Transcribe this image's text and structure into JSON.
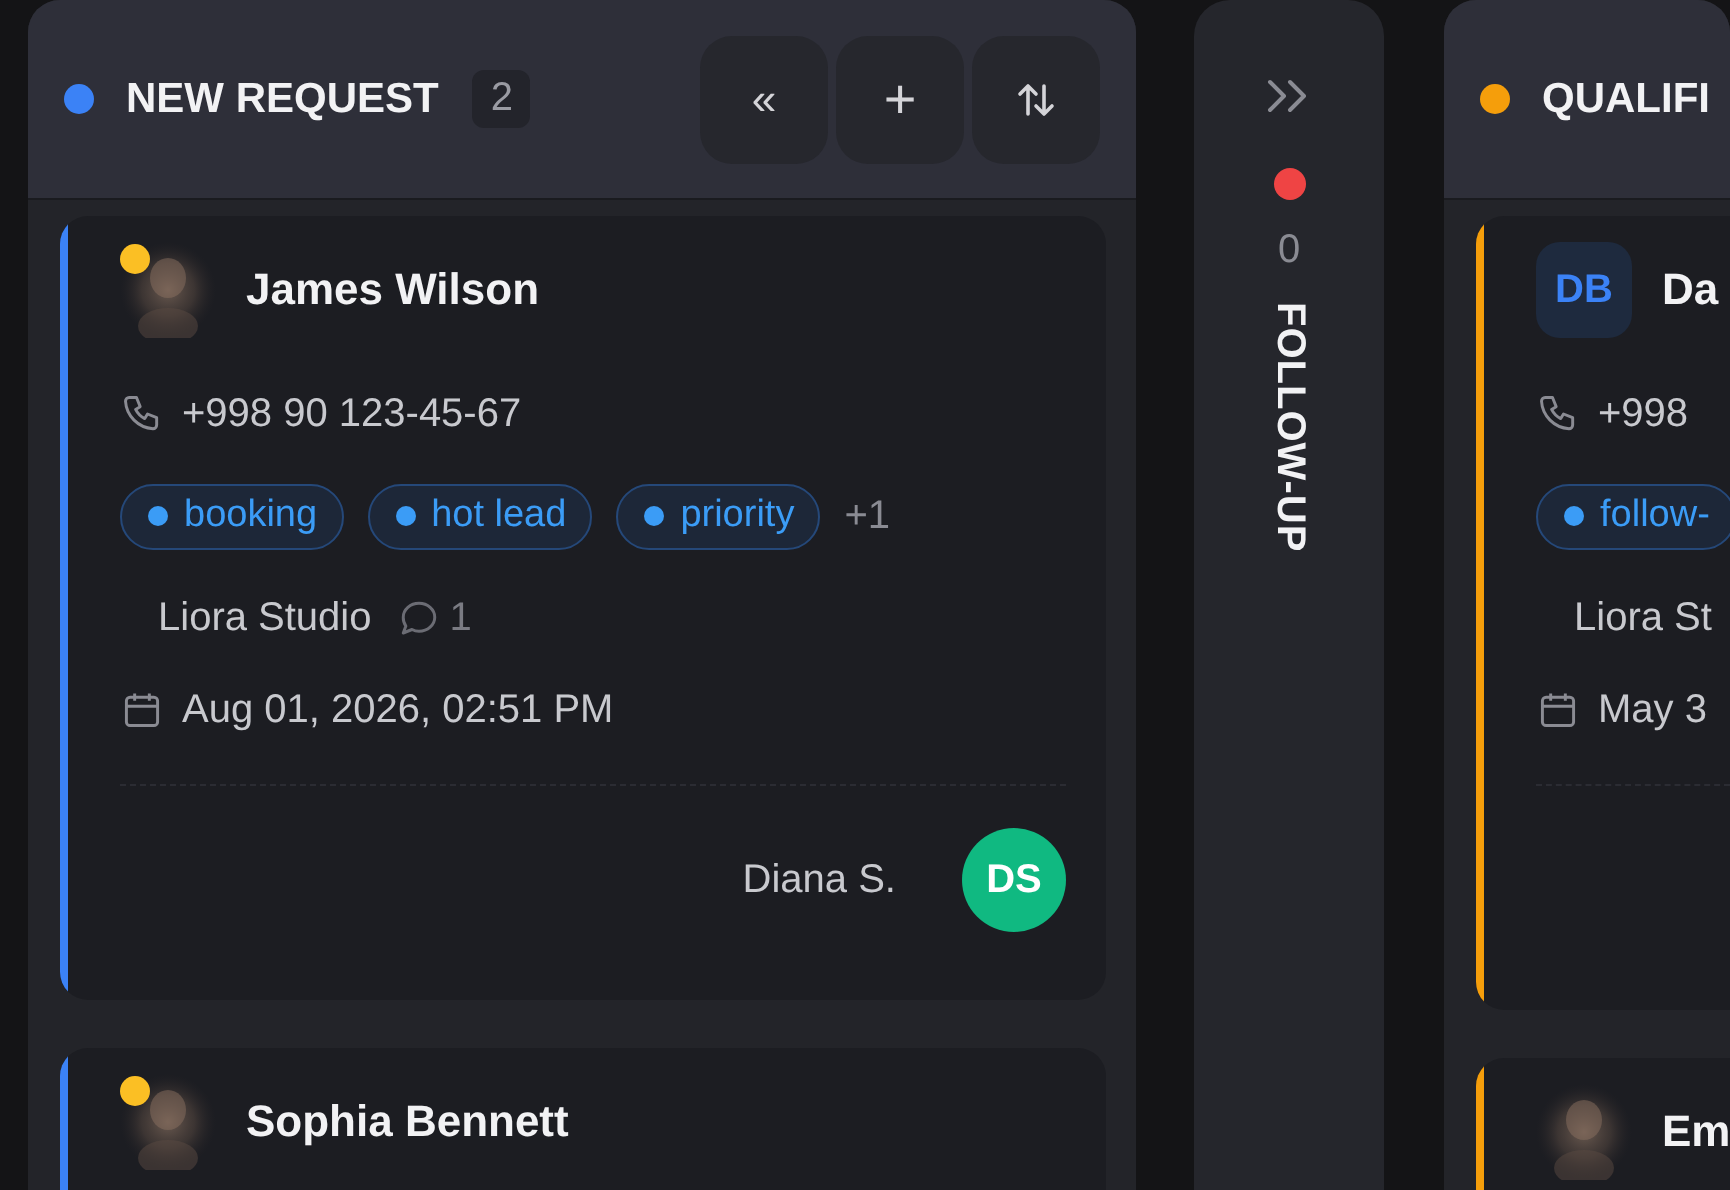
{
  "columns": [
    {
      "kind": "expanded",
      "title": "NEW REQUEST",
      "color": "#3b82f6",
      "count": "2",
      "buttons": [
        {
          "kind": "collapse",
          "label": "«"
        },
        {
          "kind": "add",
          "label": "+"
        },
        {
          "kind": "sort"
        }
      ],
      "cards": [
        {
          "name": "James Wilson",
          "color": "#fbbf24",
          "phone": "+998 90 123-45-67",
          "tags": [
            {
              "label": "booking"
            },
            {
              "label": "hot lead"
            },
            {
              "label": "priority"
            }
          ],
          "more": "+1",
          "company": "Liora Studio",
          "comments": "1",
          "date": "Aug 01, 2026, 02:51 PM",
          "assignee": {
            "name": "Diana S.",
            "initials": "DS",
            "color": "#10b981"
          }
        },
        {
          "name": "Sophia Bennett",
          "color": "#fbbf24"
        }
      ]
    },
    {
      "kind": "collapsed",
      "title": "FOLLOW-UP",
      "color": "#ef4444",
      "count": "0"
    },
    {
      "kind": "expanded",
      "title": "QUALIFI",
      "color": "#f59e0b",
      "cards": [
        {
          "name": "Da",
          "avatar": {
            "kind": "initials",
            "text": "DB"
          },
          "phone": "+998",
          "tags": [
            {
              "label": "follow-"
            }
          ],
          "company": "Liora St",
          "date": "May 3"
        },
        {
          "name": "Em"
        }
      ]
    }
  ]
}
